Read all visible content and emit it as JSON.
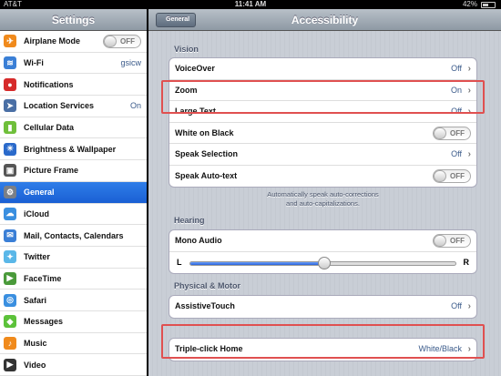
{
  "status": {
    "carrier": "AT&T",
    "time": "11:41 AM",
    "battery": "42%",
    "battery_level": 0.42
  },
  "master": {
    "title": "Settings",
    "items": [
      {
        "label": "Airplane Mode",
        "icon": "airplane-icon",
        "color": "#f08a1c",
        "glyph": "✈",
        "switch": "OFF"
      },
      {
        "label": "Wi-Fi",
        "icon": "wifi-icon",
        "color": "#3a7fd6",
        "glyph": "≋",
        "value": "gsicw"
      },
      {
        "label": "Notifications",
        "icon": "notifications-icon",
        "color": "#d62a2a",
        "glyph": "●"
      },
      {
        "label": "Location Services",
        "icon": "location-icon",
        "color": "#4a6fa5",
        "glyph": "➤",
        "value": "On"
      },
      {
        "label": "Cellular Data",
        "icon": "cellular-icon",
        "color": "#6fbf3a",
        "glyph": "▮"
      },
      {
        "label": "Brightness & Wallpaper",
        "icon": "brightness-icon",
        "color": "#2a6acb",
        "glyph": "☀"
      },
      {
        "label": "Picture Frame",
        "icon": "picture-frame-icon",
        "color": "#555555",
        "glyph": "▣"
      },
      {
        "label": "General",
        "icon": "gear-icon",
        "color": "#7a7f87",
        "glyph": "⚙",
        "selected": true
      },
      {
        "label": "iCloud",
        "icon": "icloud-icon",
        "color": "#3a8fe0",
        "glyph": "☁"
      },
      {
        "label": "Mail, Contacts, Calendars",
        "icon": "mail-icon",
        "color": "#3a7fd6",
        "glyph": "✉"
      },
      {
        "label": "Twitter",
        "icon": "twitter-icon",
        "color": "#5ab7e8",
        "glyph": "✦"
      },
      {
        "label": "FaceTime",
        "icon": "facetime-icon",
        "color": "#4a9a3a",
        "glyph": "▶"
      },
      {
        "label": "Safari",
        "icon": "safari-icon",
        "color": "#3a8fe0",
        "glyph": "◎"
      },
      {
        "label": "Messages",
        "icon": "messages-icon",
        "color": "#5cc23a",
        "glyph": "◆"
      },
      {
        "label": "Music",
        "icon": "music-icon",
        "color": "#f08a1c",
        "glyph": "♪"
      },
      {
        "label": "Video",
        "icon": "video-icon",
        "color": "#333333",
        "glyph": "▶"
      }
    ]
  },
  "detail": {
    "back": "General",
    "title": "Accessibility",
    "vision": {
      "header": "Vision",
      "rows": [
        {
          "label": "VoiceOver",
          "value": "Off"
        },
        {
          "label": "Zoom",
          "value": "On"
        },
        {
          "label": "Large Text",
          "value": "Off"
        },
        {
          "label": "White on Black",
          "switch": "OFF"
        },
        {
          "label": "Speak Selection",
          "value": "Off"
        },
        {
          "label": "Speak Auto-text",
          "switch": "OFF"
        }
      ],
      "footer_line1": "Automatically speak auto-corrections",
      "footer_line2": "and auto-capitalizations."
    },
    "hearing": {
      "header": "Hearing",
      "mono_audio": "Mono Audio",
      "mono_switch": "OFF",
      "left": "L",
      "right": "R",
      "balance": 0.5
    },
    "motor": {
      "header": "Physical & Motor",
      "assistive": "AssistiveTouch",
      "assistive_value": "Off"
    },
    "triple": {
      "label": "Triple-click Home",
      "value": "White/Black"
    },
    "highlight_color": "#e05050"
  }
}
